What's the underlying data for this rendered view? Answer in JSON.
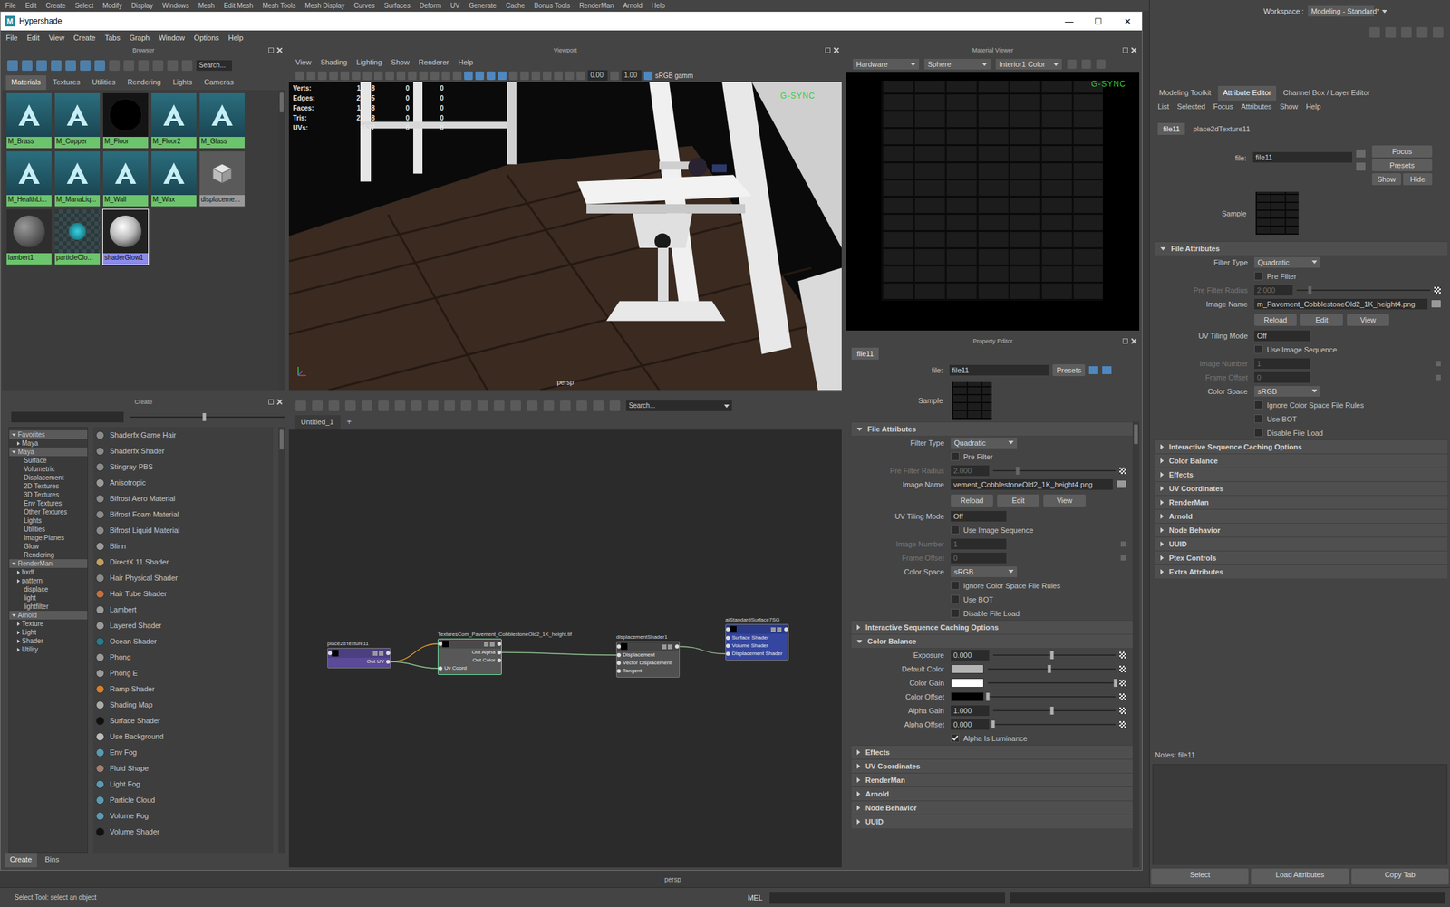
{
  "maya": {
    "menu": [
      "File",
      "Edit",
      "Create",
      "Select",
      "Modify",
      "Display",
      "Windows",
      "Mesh",
      "Edit Mesh",
      "Mesh Tools",
      "Mesh Display",
      "Curves",
      "Surfaces",
      "Deform",
      "UV",
      "Generate",
      "Cache",
      "Bonus Tools",
      "RenderMan",
      "Arnold",
      "Help"
    ],
    "workspace_label": "Workspace :",
    "workspace": "Modeling - Standard*",
    "viewport_label": "persp",
    "status": "Select Tool: select an object",
    "command_lang": "MEL"
  },
  "hypershade": {
    "logo": "M",
    "title": "Hypershade",
    "controls": [
      "—",
      "☐",
      "✕"
    ],
    "menu": [
      "File",
      "Edit",
      "View",
      "Create",
      "Tabs",
      "Graph",
      "Window",
      "Options",
      "Help"
    ],
    "browser": {
      "title": "Browser",
      "search_placeholder": "Search...",
      "tabs": [
        {
          "label": "Materials",
          "selected": true
        },
        {
          "label": "Textures",
          "selected": false
        },
        {
          "label": "Utilities",
          "selected": false
        },
        {
          "label": "Rendering",
          "selected": false
        },
        {
          "label": "Lights",
          "selected": false
        },
        {
          "label": "Cameras",
          "selected": false
        }
      ],
      "materials": [
        {
          "name": "M_Brass",
          "kind": "arnold",
          "color": "#6cc46c",
          "selected": false
        },
        {
          "name": "M_Copper",
          "kind": "arnold",
          "color": "#6cc46c",
          "selected": false
        },
        {
          "name": "M_Floor",
          "kind": "black",
          "color": "#6cc46c",
          "selected": false
        },
        {
          "name": "M_Floor2",
          "kind": "arnold",
          "color": "#6cc46c",
          "selected": false
        },
        {
          "name": "M_Glass",
          "kind": "arnold",
          "color": "#6cc46c",
          "selected": false
        },
        {
          "name": "M_HealthLi...",
          "kind": "arnold",
          "color": "#6cc46c",
          "selected": false
        },
        {
          "name": "M_ManaLiq...",
          "kind": "arnold",
          "color": "#6cc46c",
          "selected": false
        },
        {
          "name": "M_Wall",
          "kind": "arnold",
          "color": "#6cc46c",
          "selected": false
        },
        {
          "name": "M_Wax",
          "kind": "arnold",
          "color": "#6cc46c",
          "selected": false
        },
        {
          "name": "displaceme...",
          "kind": "displacement",
          "color": "#9a9a9a",
          "selected": false
        },
        {
          "name": "lambert1",
          "kind": "lambert",
          "color": "#6cc46c",
          "selected": false
        },
        {
          "name": "particleClo...",
          "kind": "checker",
          "color": "#6cc46c",
          "selected": false
        },
        {
          "name": "shaderGlow1",
          "kind": "glow",
          "color": "#8b8bea",
          "selected": true
        }
      ]
    },
    "viewport": {
      "title": "Viewport",
      "menu": [
        "View",
        "Shading",
        "Lighting",
        "Show",
        "Renderer",
        "Help"
      ],
      "exposure": "0.00",
      "gamma": "1.00",
      "color_space": "sRGB gamm",
      "stats": [
        {
          "label": "Verts:",
          "values": [
            "11228",
            "0",
            "0"
          ]
        },
        {
          "label": "Edges:",
          "values": [
            "22395",
            "0",
            "0"
          ]
        },
        {
          "label": "Faces:",
          "values": [
            "11238",
            "0",
            "0"
          ]
        },
        {
          "label": "Tris:",
          "values": [
            "22158",
            "0",
            "0"
          ]
        },
        {
          "label": "UVs:",
          "values": [
            "9537",
            "0",
            "0"
          ]
        }
      ],
      "camera": "persp",
      "gsync": "G-SYNC"
    },
    "material_viewer": {
      "title": "Material Viewer",
      "renderer": "Hardware",
      "geometry": "Sphere",
      "environment": "Interior1 Color",
      "gsync": "G-SYNC"
    },
    "create": {
      "title": "Create",
      "zoom_level": 0.48,
      "tree": [
        {
          "label": "Favorites",
          "kind": "header",
          "expanded": true
        },
        {
          "label": "Maya",
          "kind": "branch",
          "expanded": false
        },
        {
          "label": "Maya",
          "kind": "header",
          "expanded": true
        },
        {
          "label": "Surface",
          "kind": "leaf"
        },
        {
          "label": "Volumetric",
          "kind": "leaf"
        },
        {
          "label": "Displacement",
          "kind": "leaf"
        },
        {
          "label": "2D Textures",
          "kind": "leaf"
        },
        {
          "label": "3D Textures",
          "kind": "leaf"
        },
        {
          "label": "Env Textures",
          "kind": "leaf"
        },
        {
          "label": "Other Textures",
          "kind": "leaf"
        },
        {
          "label": "Lights",
          "kind": "leaf"
        },
        {
          "label": "Utilities",
          "kind": "leaf"
        },
        {
          "label": "Image Planes",
          "kind": "leaf"
        },
        {
          "label": "Glow",
          "kind": "leaf"
        },
        {
          "label": "Rendering",
          "kind": "leaf"
        },
        {
          "label": "RenderMan",
          "kind": "header",
          "expanded": true
        },
        {
          "label": "bxdf",
          "kind": "branch",
          "expanded": false
        },
        {
          "label": "pattern",
          "kind": "branch",
          "expanded": false
        },
        {
          "label": "displace",
          "kind": "leaf"
        },
        {
          "label": "light",
          "kind": "leaf"
        },
        {
          "label": "lightfilter",
          "kind": "leaf"
        },
        {
          "label": "Arnold",
          "kind": "header",
          "expanded": true
        },
        {
          "label": "Texture",
          "kind": "branch",
          "expanded": false
        },
        {
          "label": "Light",
          "kind": "branch",
          "expanded": false
        },
        {
          "label": "Shader",
          "kind": "branch",
          "expanded": false
        },
        {
          "label": "Utility",
          "kind": "branch",
          "expanded": false
        }
      ],
      "items": [
        {
          "label": "Shaderfx Game Hair",
          "color": "#8a8a8a"
        },
        {
          "label": "Shaderfx Shader",
          "color": "#8a8a8a"
        },
        {
          "label": "Stingray PBS",
          "color": "#8a8a8a"
        },
        {
          "label": "Anisotropic",
          "color": "#9a9a9a"
        },
        {
          "label": "Bifrost Aero Material",
          "color": "#8a8a8a"
        },
        {
          "label": "Bifrost Foam Material",
          "color": "#8a8a8a"
        },
        {
          "label": "Bifrost Liquid Material",
          "color": "#8a8a8a"
        },
        {
          "label": "Blinn",
          "color": "#9a9a9a"
        },
        {
          "label": "DirectX 11 Shader",
          "color": "#c0a060"
        },
        {
          "label": "Hair Physical Shader",
          "color": "#8a8a8a"
        },
        {
          "label": "Hair Tube Shader",
          "color": "#c07040"
        },
        {
          "label": "Lambert",
          "color": "#9a9a9a"
        },
        {
          "label": "Layered Shader",
          "color": "#9a9a9a"
        },
        {
          "label": "Ocean Shader",
          "color": "#2a7a8a"
        },
        {
          "label": "Phong",
          "color": "#9a9a9a"
        },
        {
          "label": "Phong E",
          "color": "#9a9a9a"
        },
        {
          "label": "Ramp Shader",
          "color": "#d08030"
        },
        {
          "label": "Shading Map",
          "color": "#aaaaaa"
        },
        {
          "label": "Surface Shader",
          "color": "#111111"
        },
        {
          "label": "Use Background",
          "color": "#bbbbbb"
        },
        {
          "label": "Env Fog",
          "color": "#5a9ab0"
        },
        {
          "label": "Fluid Shape",
          "color": "#a08070"
        },
        {
          "label": "Light Fog",
          "color": "#5a9ab0"
        },
        {
          "label": "Particle Cloud",
          "color": "#5a9ab0"
        },
        {
          "label": "Volume Fog",
          "color": "#5a9ab0"
        },
        {
          "label": "Volume Shader",
          "color": "#111111"
        }
      ],
      "tabs": [
        {
          "label": "Create",
          "selected": true
        },
        {
          "label": "Bins",
          "selected": false
        }
      ]
    },
    "node_editor": {
      "tab": "Untitled_1",
      "add_tab": "+",
      "search_placeholder": "Search...",
      "nodes": [
        {
          "title": "place2dTexture11",
          "color": "#5a4a98",
          "selected": false,
          "ports": [
            {
              "label": "Out UV",
              "dir": "out"
            }
          ]
        },
        {
          "title": "TexturesCom_Pavement_CobblestoneOld2_1K_height.tif",
          "color": "#585858",
          "selected": true,
          "ports": [
            {
              "label": "Out Alpha",
              "dir": "out"
            },
            {
              "label": "Out Color",
              "dir": "out"
            },
            {
              "label": "Uv Coord",
              "dir": "in"
            }
          ]
        },
        {
          "title": "displacementShader1",
          "color": "#505050",
          "selected": false,
          "ports": [
            {
              "label": "Displacement",
              "dir": "in"
            },
            {
              "label": "Vector Displacement",
              "dir": "in"
            },
            {
              "label": "Tangent",
              "dir": "in"
            }
          ]
        },
        {
          "title": "aiStandardSurface7SG",
          "color": "#3446a0",
          "selected": false,
          "ports": [
            {
              "label": "Surface Shader",
              "dir": "in"
            },
            {
              "label": "Volume Shader",
              "dir": "in"
            },
            {
              "label": "Displacement Shader",
              "dir": "in"
            }
          ]
        }
      ],
      "edges": [
        {
          "from": [
            0,
            0
          ],
          "to": [
            1,
            -1
          ],
          "color": "#f0a030"
        },
        {
          "from": [
            0,
            0
          ],
          "to": [
            1,
            2
          ],
          "color": "#8fbf8f"
        },
        {
          "from": [
            1,
            0
          ],
          "to": [
            2,
            0
          ],
          "color": "#8fbf8f"
        },
        {
          "from": [
            2,
            -1
          ],
          "to": [
            3,
            2
          ],
          "color": "#8fbf8f"
        }
      ]
    },
    "property_editor": {
      "title": "Property Editor",
      "tab": "file11",
      "node_label": "file:",
      "node_name": "file11",
      "presets": "Presets",
      "sample_label": "Sample",
      "sections": [
        {
          "title": "File Attributes",
          "expanded": true,
          "rows": [
            {
              "kind": "dropdown",
              "label": "Filter Type",
              "value": "Quadratic"
            },
            {
              "kind": "checkbox",
              "label": "Pre Filter",
              "checked": false
            },
            {
              "kind": "slider",
              "label": "Pre Filter Radius",
              "value": "2.000",
              "level": 0.2,
              "disabled": true
            },
            {
              "kind": "file",
              "label": "Image Name",
              "value": "vement_CobblestoneOld2_1K_height4.png"
            },
            {
              "kind": "buttons",
              "items": [
                "Reload",
                "Edit",
                "View"
              ]
            },
            {
              "kind": "field",
              "label": "UV Tiling Mode",
              "value": "Off",
              "disabled": false
            },
            {
              "kind": "checkbox",
              "label": "Use Image Sequence",
              "checked": false
            },
            {
              "kind": "field",
              "label": "Image Number",
              "value": "1",
              "disabled": true
            },
            {
              "kind": "field",
              "label": "Frame Offset",
              "value": "0",
              "disabled": true
            },
            {
              "kind": "dropdown",
              "label": "Color Space",
              "value": "sRGB"
            },
            {
              "kind": "checkbox",
              "label": "Ignore Color Space File Rules",
              "checked": false
            },
            {
              "kind": "checkbox",
              "label": "Use BOT",
              "checked": false
            },
            {
              "kind": "checkbox",
              "label": "Disable File Load",
              "checked": false
            }
          ]
        },
        {
          "title": "Interactive Sequence Caching Options",
          "expanded": false,
          "rows": []
        },
        {
          "title": "Color Balance",
          "expanded": true,
          "rows": [
            {
              "kind": "slider",
              "label": "Exposure",
              "value": "0.000",
              "level": 0.48,
              "disabled": false
            },
            {
              "kind": "color",
              "label": "Default Color",
              "color": "#b4b4b4",
              "level": 0.48
            },
            {
              "kind": "color",
              "label": "Color Gain",
              "color": "#ffffff",
              "level": 1.0
            },
            {
              "kind": "color",
              "label": "Color Offset",
              "color": "#000000",
              "level": 0.0
            },
            {
              "kind": "slider",
              "label": "Alpha Gain",
              "value": "1.000",
              "level": 0.48,
              "disabled": false
            },
            {
              "kind": "slider",
              "label": "Alpha Offset",
              "value": "0.000",
              "level": 0.0,
              "disabled": false
            },
            {
              "kind": "checkbox",
              "label": "Alpha Is Luminance",
              "checked": true
            }
          ]
        },
        {
          "title": "Effects",
          "expanded": false,
          "rows": []
        },
        {
          "title": "UV Coordinates",
          "expanded": false,
          "rows": []
        },
        {
          "title": "RenderMan",
          "expanded": false,
          "rows": []
        },
        {
          "title": "Arnold",
          "expanded": false,
          "rows": []
        },
        {
          "title": "Node Behavior",
          "expanded": false,
          "rows": []
        },
        {
          "title": "UUID",
          "expanded": false,
          "rows": []
        }
      ]
    }
  },
  "attribute_editor": {
    "tabs": [
      {
        "label": "Modeling Toolkit",
        "selected": false
      },
      {
        "label": "Attribute Editor",
        "selected": true
      },
      {
        "label": "Channel Box / Layer Editor",
        "selected": false
      }
    ],
    "menu": [
      "List",
      "Selected",
      "Focus",
      "Attributes",
      "Show",
      "Help"
    ],
    "node_tabs": [
      {
        "label": "file11",
        "selected": true
      },
      {
        "label": "place2dTexture11",
        "selected": false
      }
    ],
    "node_label": "file:",
    "node_name": "file11",
    "buttons": [
      "Focus",
      "Presets",
      "Show",
      "Hide"
    ],
    "sample_label": "Sample",
    "sections": [
      {
        "title": "File Attributes",
        "expanded": true,
        "rows": [
          {
            "kind": "dropdown",
            "label": "Filter Type",
            "value": "Quadratic"
          },
          {
            "kind": "checkbox",
            "label": "Pre Filter",
            "checked": false
          },
          {
            "kind": "slider",
            "label": "Pre Filter Radius",
            "value": "2.000",
            "level": 0.1,
            "disabled": true
          },
          {
            "kind": "file",
            "label": "Image Name",
            "value": "m_Pavement_CobblestoneOld2_1K_height4.png"
          },
          {
            "kind": "buttons",
            "items": [
              "Reload",
              "Edit",
              "View"
            ]
          },
          {
            "kind": "field",
            "label": "UV Tiling Mode",
            "value": "Off",
            "disabled": false
          },
          {
            "kind": "checkbox",
            "label": "Use Image Sequence",
            "checked": false
          },
          {
            "kind": "field",
            "label": "Image Number",
            "value": "1",
            "disabled": true
          },
          {
            "kind": "field",
            "label": "Frame Offset",
            "value": "0",
            "disabled": true
          },
          {
            "kind": "dropdown",
            "label": "Color Space",
            "value": "sRGB"
          },
          {
            "kind": "checkbox",
            "label": "Ignore Color Space File Rules",
            "checked": false
          },
          {
            "kind": "checkbox",
            "label": "Use BOT",
            "checked": false
          },
          {
            "kind": "checkbox",
            "label": "Disable File Load",
            "checked": false
          }
        ]
      },
      {
        "title": "Interactive Sequence Caching Options",
        "expanded": false,
        "rows": []
      },
      {
        "title": "Color Balance",
        "expanded": false,
        "rows": []
      },
      {
        "title": "Effects",
        "expanded": false,
        "rows": []
      },
      {
        "title": "UV Coordinates",
        "expanded": false,
        "rows": []
      },
      {
        "title": "RenderMan",
        "expanded": false,
        "rows": []
      },
      {
        "title": "Arnold",
        "expanded": false,
        "rows": []
      },
      {
        "title": "Node Behavior",
        "expanded": false,
        "rows": []
      },
      {
        "title": "UUID",
        "expanded": false,
        "rows": []
      },
      {
        "title": "Ptex Controls",
        "expanded": false,
        "rows": []
      },
      {
        "title": "Extra Attributes",
        "expanded": false,
        "rows": []
      }
    ],
    "notes": "Notes: file11",
    "footer": [
      "Select",
      "Load Attributes",
      "Copy Tab"
    ]
  }
}
